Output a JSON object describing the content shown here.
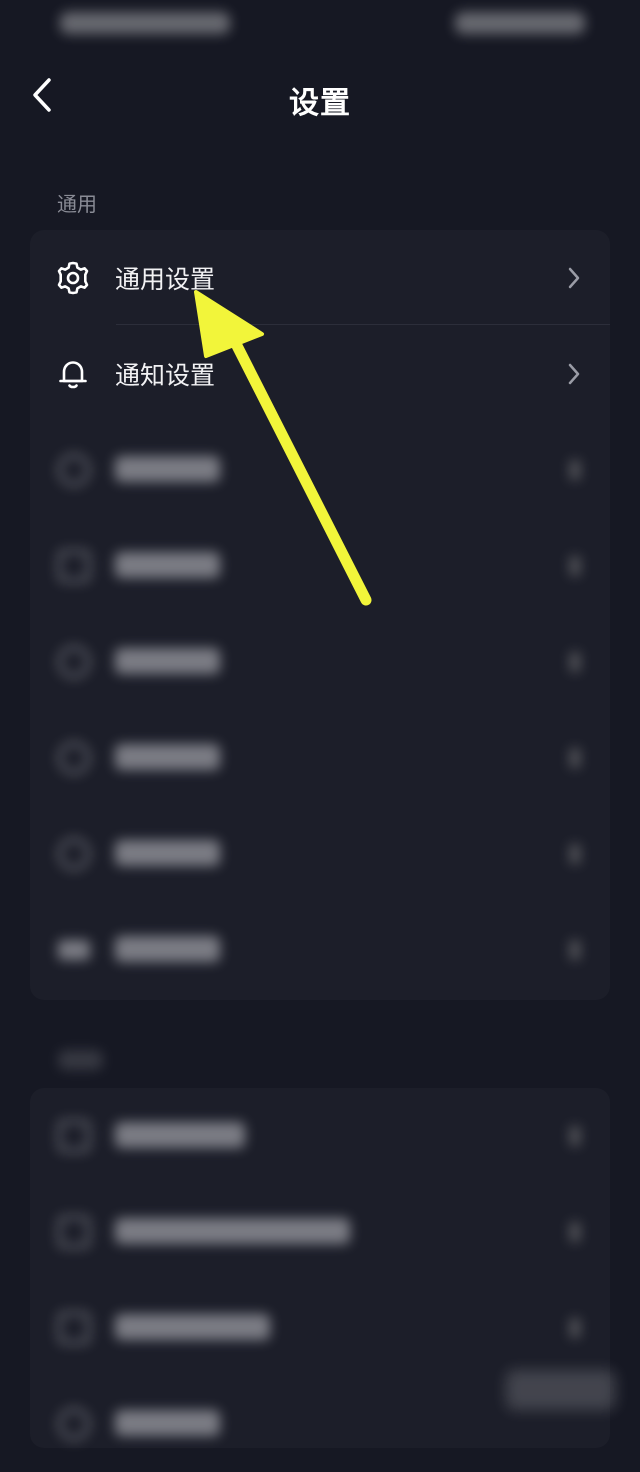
{
  "header": {
    "title": "设置"
  },
  "section_general": {
    "label": "通用",
    "items": [
      {
        "label": "通用设置",
        "icon": "gear-icon"
      },
      {
        "label": "通知设置",
        "icon": "bell-icon"
      }
    ]
  },
  "colors": {
    "background": "#161823",
    "card": "#1c1e29",
    "arrow": "#f2f53a"
  }
}
